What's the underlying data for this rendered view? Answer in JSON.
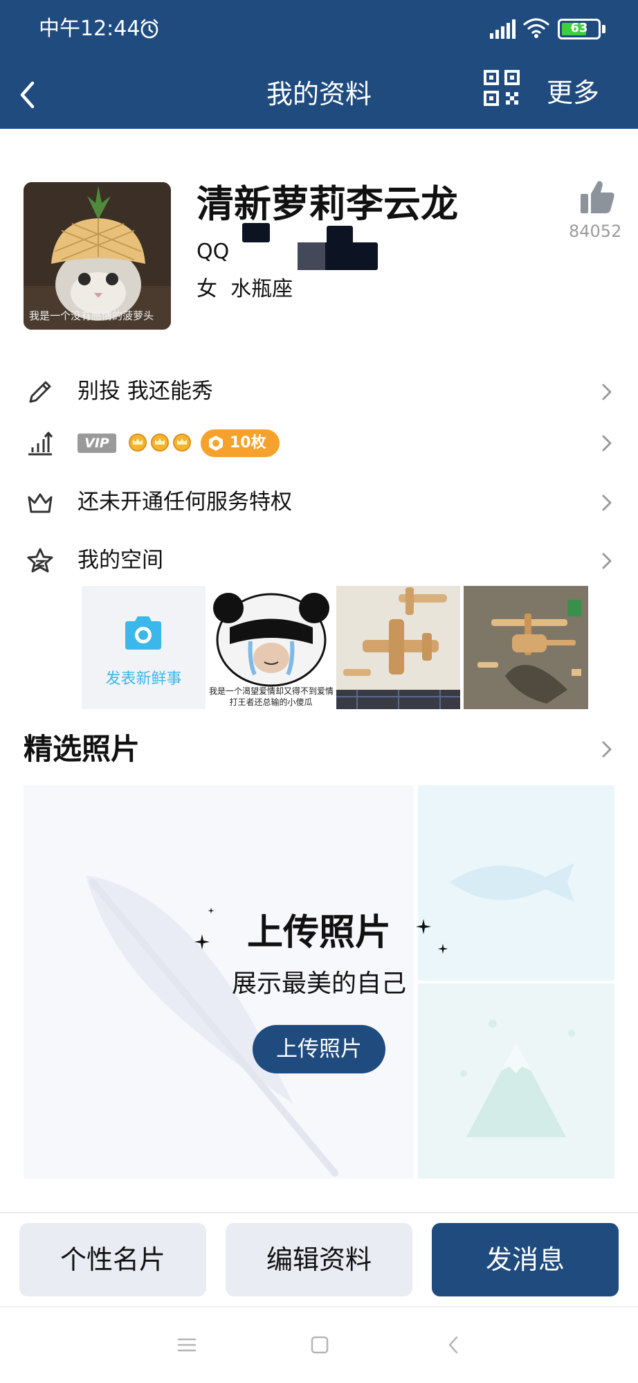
{
  "status_bar": {
    "time": "中午12:44",
    "battery": "63"
  },
  "navbar": {
    "title": "我的资料",
    "more_label": "更多"
  },
  "profile": {
    "nickname": "清新萝莉李云龙",
    "qq_label": "QQ",
    "gender": "女",
    "zodiac": "水瓶座",
    "like_count": "84052",
    "avatar_caption": "我是一个没有感情的菠萝头"
  },
  "rows": {
    "signature": "别投 我还能秀",
    "vip_tag": "VIP",
    "badge_count": "10枚",
    "privilege": "还未开通任何服务特权",
    "space": "我的空间"
  },
  "space": {
    "post_label": "发表新鲜事",
    "meme_caption_line1": "我是一个渴望爱情却又得不到爱情",
    "meme_caption_line2": "打王者还总输的小傻瓜"
  },
  "photos": {
    "section_title": "精选照片",
    "upload_title": "上传照片",
    "upload_subtitle": "展示最美的自己",
    "upload_button": "上传照片"
  },
  "actions": {
    "card": "个性名片",
    "edit": "编辑资料",
    "message": "发消息"
  },
  "colors": {
    "brand": "#1f4b7f",
    "accent_blue": "#3cb7ea",
    "badge_orange": "#f6a12b"
  }
}
